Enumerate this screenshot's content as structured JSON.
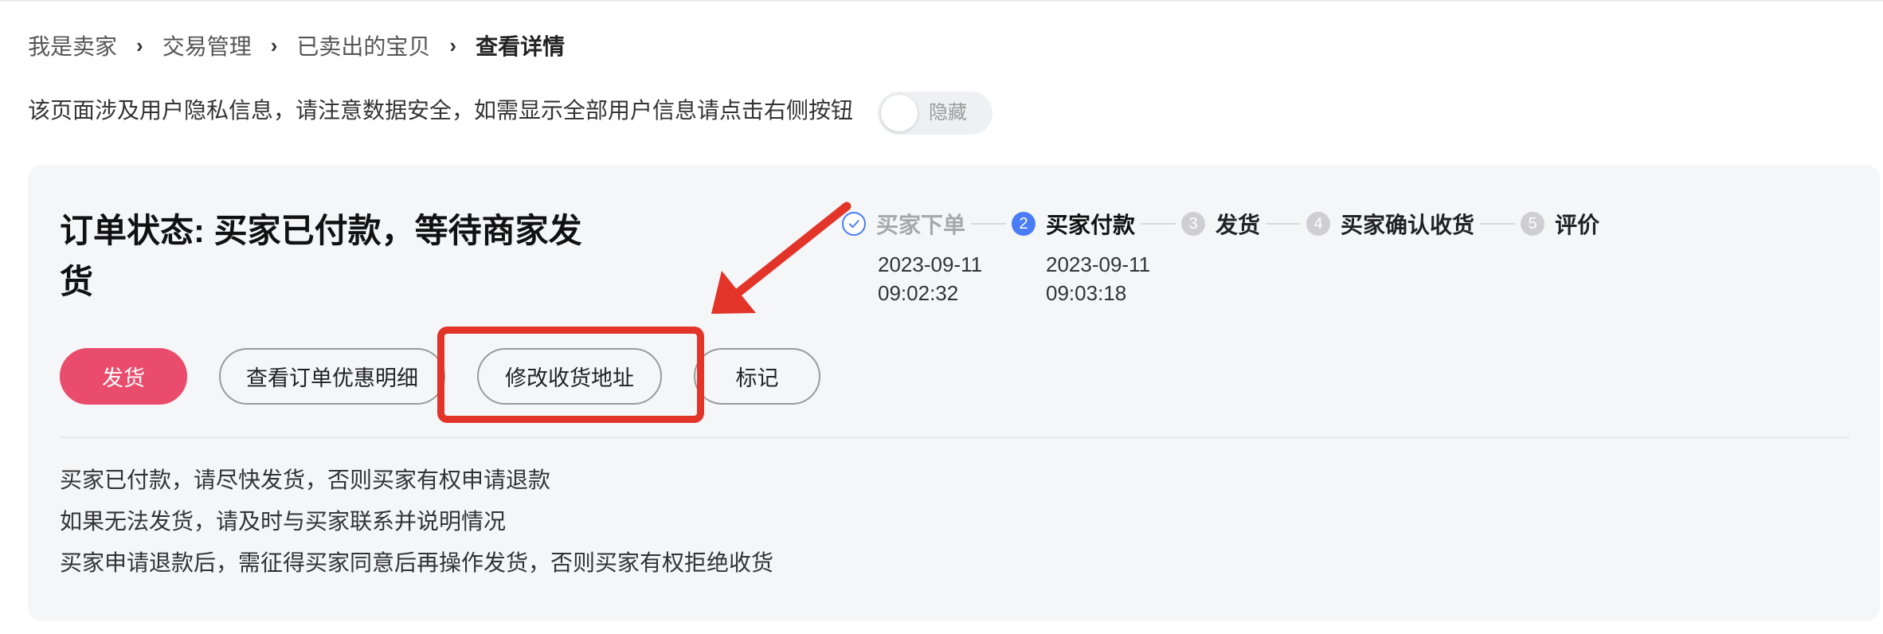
{
  "breadcrumb": {
    "separator": "›",
    "items": [
      "我是卖家",
      "交易管理",
      "已卖出的宝贝",
      "查看详情"
    ]
  },
  "privacy": {
    "notice": "该页面涉及用户隐私信息，请注意数据安全，如需显示全部用户信息请点击右侧按钮",
    "toggle_label": "隐藏",
    "toggle_on": false
  },
  "order": {
    "status_title": "订单状态: 买家已付款，等待商家发货",
    "current_step": 2,
    "steps": [
      {
        "icon": "check-icon",
        "label": "买家下单",
        "date": "2023-09-11",
        "time": "09:02:32"
      },
      {
        "number": "2",
        "label": "买家付款",
        "date": "2023-09-11",
        "time": "09:03:18"
      },
      {
        "number": "3",
        "label": "发货"
      },
      {
        "number": "4",
        "label": "买家确认收货"
      },
      {
        "number": "5",
        "label": "评价"
      }
    ],
    "actions": {
      "ship": "发货",
      "view_discount": "查看订单优惠明细",
      "edit_address": "修改收货地址",
      "mark": "标记"
    },
    "notes": [
      "买家已付款，请尽快发货，否则买家有权申请退款",
      "如果无法发货，请及时与买家联系并说明情况",
      "买家申请退款后，需征得买家同意后再操作发货，否则买家有权拒绝收货"
    ]
  },
  "colors": {
    "accent": "#4a7cf6",
    "primary": "#ea4c6d",
    "annotation": "#e3342a",
    "card-bg": "#f5f6f8"
  }
}
